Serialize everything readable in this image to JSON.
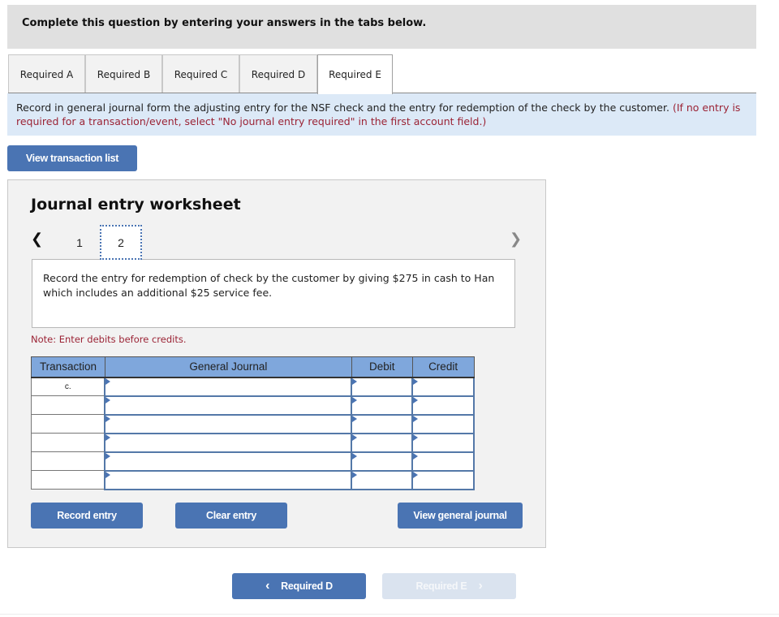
{
  "header": {
    "title": "Complete this question by entering your answers in the tabs below."
  },
  "tabs": [
    {
      "label": "Required A",
      "active": false
    },
    {
      "label": "Required B",
      "active": false
    },
    {
      "label": "Required C",
      "active": false
    },
    {
      "label": "Required D",
      "active": false
    },
    {
      "label": "Required E",
      "active": true
    }
  ],
  "instructions": {
    "text": "Record in general journal form the adjusting entry for the NSF check and the entry for redemption of the check by the customer.",
    "hint": "(If no entry is required for a transaction/event, select \"No journal entry required\" in the first account field.)"
  },
  "view_transaction_list_label": "View transaction list",
  "worksheet": {
    "title": "Journal entry worksheet",
    "pager": {
      "prev_icon": "chevron-left-icon",
      "next_icon": "chevron-right-icon",
      "pages": [
        "1",
        "2"
      ],
      "current": "2"
    },
    "description": "Record the entry for redemption of check by the customer by giving $275 in cash to Han which includes an additional $25 service fee.",
    "note": "Note: Enter debits before credits.",
    "table": {
      "headers": [
        "Transaction",
        "General Journal",
        "Debit",
        "Credit"
      ],
      "rows": [
        {
          "transaction": "c.",
          "account": "",
          "debit": "",
          "credit": ""
        },
        {
          "transaction": "",
          "account": "",
          "debit": "",
          "credit": ""
        },
        {
          "transaction": "",
          "account": "",
          "debit": "",
          "credit": ""
        },
        {
          "transaction": "",
          "account": "",
          "debit": "",
          "credit": ""
        },
        {
          "transaction": "",
          "account": "",
          "debit": "",
          "credit": ""
        },
        {
          "transaction": "",
          "account": "",
          "debit": "",
          "credit": ""
        }
      ]
    },
    "buttons": {
      "record": "Record entry",
      "clear": "Clear entry",
      "view_journal": "View general journal"
    }
  },
  "nav": {
    "prev_label": "Required D",
    "next_label": "Required E",
    "prev_icon": "‹",
    "next_icon": "›",
    "next_disabled": true
  },
  "colors": {
    "accent": "#4a74b3",
    "header_bg": "#7fa7dc",
    "hint_red": "#9b2335",
    "info_bg": "#dce9f7"
  }
}
